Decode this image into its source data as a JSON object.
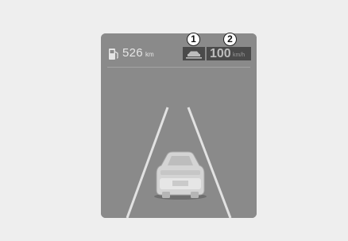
{
  "cluster": {
    "range_value": "526",
    "range_unit": "km",
    "set_speed_value": "100",
    "set_speed_unit": "km/h"
  },
  "callouts": [
    "1",
    "2"
  ],
  "icons": {
    "fuel": "fuel-pump-icon",
    "following_distance": "vehicle-distance-icon",
    "vehicle_ahead": "vehicle-ahead-icon"
  }
}
